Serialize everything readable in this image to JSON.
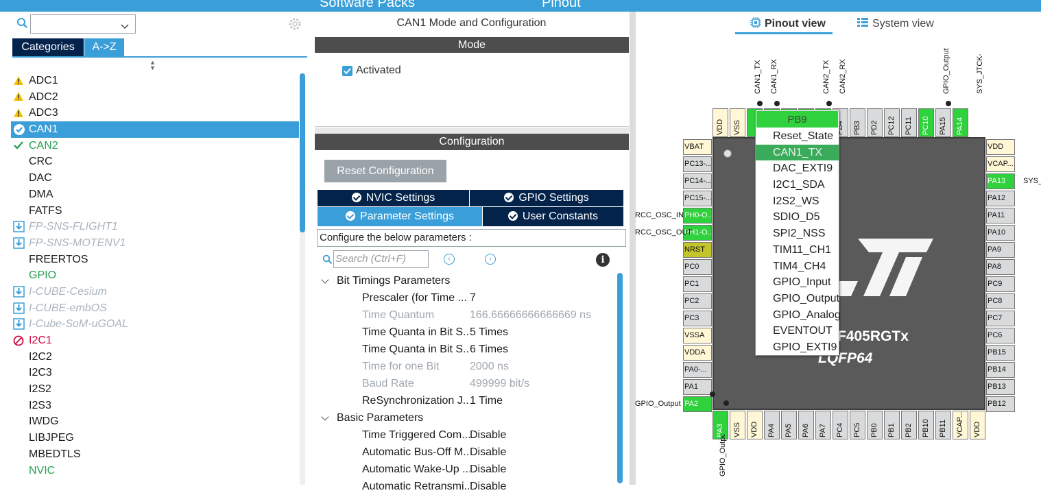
{
  "topbar": {
    "left_label": "Software Packs",
    "right_label": "Pinout"
  },
  "left_panel": {
    "search_value": "",
    "tabs": [
      {
        "label": "Categories"
      },
      {
        "label": "A->Z"
      }
    ],
    "items": [
      {
        "label": "ADC1",
        "state": "warning"
      },
      {
        "label": "ADC2",
        "state": "warning"
      },
      {
        "label": "ADC3",
        "state": "warning"
      },
      {
        "label": "CAN1",
        "state": "selected"
      },
      {
        "label": "CAN2",
        "state": "enabled"
      },
      {
        "label": "CRC",
        "state": "normal"
      },
      {
        "label": "DAC",
        "state": "normal"
      },
      {
        "label": "DMA",
        "state": "normal"
      },
      {
        "label": "FATFS",
        "state": "normal"
      },
      {
        "label": "FP-SNS-FLIGHT1",
        "state": "pack"
      },
      {
        "label": "FP-SNS-MOTENV1",
        "state": "pack"
      },
      {
        "label": "FREERTOS",
        "state": "normal"
      },
      {
        "label": "GPIO",
        "state": "green"
      },
      {
        "label": "I-CUBE-Cesium",
        "state": "pack"
      },
      {
        "label": "I-CUBE-embOS",
        "state": "pack"
      },
      {
        "label": "I-Cube-SoM-uGOAL",
        "state": "pack"
      },
      {
        "label": "I2C1",
        "state": "error"
      },
      {
        "label": "I2C2",
        "state": "normal"
      },
      {
        "label": "I2C3",
        "state": "normal"
      },
      {
        "label": "I2S2",
        "state": "normal"
      },
      {
        "label": "I2S3",
        "state": "normal"
      },
      {
        "label": "IWDG",
        "state": "normal"
      },
      {
        "label": "LIBJPEG",
        "state": "normal"
      },
      {
        "label": "MBEDTLS",
        "state": "normal"
      },
      {
        "label": "NVIC",
        "state": "green"
      }
    ]
  },
  "middle_panel": {
    "title": "CAN1 Mode and Configuration",
    "mode_header": "Mode",
    "activated_label": "Activated",
    "activated": true,
    "config_header": "Configuration",
    "reset_button": "Reset Configuration",
    "settings_tabs": [
      {
        "label": "NVIC Settings"
      },
      {
        "label": "GPIO Settings"
      },
      {
        "label": "Parameter Settings"
      },
      {
        "label": "User Constants"
      }
    ],
    "param_hint": "Configure the below parameters :",
    "search_placeholder": "Search (Ctrl+F)",
    "sections": [
      {
        "title": "Bit Timings Parameters",
        "rows": [
          {
            "key": "Prescaler (for Time ...",
            "value": "7",
            "disabled": false
          },
          {
            "key": "Time Quantum",
            "value": "166.66666666666669 ns",
            "disabled": true
          },
          {
            "key": "Time Quanta in Bit S...",
            "value": "5 Times",
            "disabled": false
          },
          {
            "key": "Time Quanta in Bit S...",
            "value": "6 Times",
            "disabled": false
          },
          {
            "key": "Time for one Bit",
            "value": "2000 ns",
            "disabled": true
          },
          {
            "key": "Baud Rate",
            "value": "499999 bit/s",
            "disabled": true
          },
          {
            "key": "ReSynchronization J...",
            "value": "1 Time",
            "disabled": false
          }
        ]
      },
      {
        "title": "Basic Parameters",
        "rows": [
          {
            "key": "Time Triggered Com...",
            "value": "Disable",
            "disabled": false
          },
          {
            "key": "Automatic Bus-Off M...",
            "value": "Disable",
            "disabled": false
          },
          {
            "key": "Automatic Wake-Up ...",
            "value": "Disable",
            "disabled": false
          },
          {
            "key": "Automatic Retransmi...",
            "value": "Disable",
            "disabled": false
          }
        ]
      }
    ]
  },
  "right_panel": {
    "tabs": [
      {
        "label": "Pinout view"
      },
      {
        "label": "System view"
      }
    ],
    "chip_part": "F405RGTx",
    "chip_package": "LQFP64",
    "top_labels": {
      "can1_tx": "CAN1_TX",
      "can1_rx": "CAN1_RX",
      "can2_tx": "CAN2_TX",
      "can2_rx": "CAN2_RX",
      "gpio_output": "GPIO_Output",
      "sys_jtck": "SYS_JTCK-SW"
    },
    "side_labels": {
      "osc_in": "RCC_OSC_IN",
      "osc_out": "RCC_OSC_OUT",
      "gpio_output_left": "GPIO_Output",
      "sys_right": "SYS_",
      "gpio_output_bottom": "GPIO_Output"
    },
    "top_pins": [
      "VDD",
      "VSS",
      "",
      "",
      "",
      "",
      "PB5",
      "PB4",
      "PB3",
      "PD2",
      "PC12",
      "PC11",
      "PC10",
      "PA15",
      "PA14"
    ],
    "left_pins": [
      "VBAT",
      "PC13-...",
      "PC14-...",
      "PC15-...",
      "PH0-O...",
      "PH1-O...",
      "NRST",
      "PC0",
      "PC1",
      "PC2",
      "PC3",
      "VSSA",
      "VDDA",
      "PA0-...",
      "PA1",
      "PA2"
    ],
    "right_pins": [
      "VDD",
      "VCAP...",
      "PA13",
      "PA12",
      "PA11",
      "PA10",
      "PA9",
      "PA8",
      "PC9",
      "PC8",
      "PC7",
      "PC6",
      "PB15",
      "PB14",
      "PB13",
      "PB12"
    ],
    "bottom_pins": [
      "PA3",
      "VSS",
      "VDD",
      "PA4",
      "PA5",
      "PA6",
      "PA7",
      "PC4",
      "PC5",
      "PB0",
      "PB1",
      "PB2",
      "PB10",
      "PB11",
      "VCAP...",
      "VDD"
    ]
  },
  "popup": {
    "header": "PB9",
    "items": [
      {
        "label": "Reset_State",
        "selected": false
      },
      {
        "label": "CAN1_TX",
        "selected": true
      },
      {
        "label": "DAC_EXTI9",
        "selected": false
      },
      {
        "label": "I2C1_SDA",
        "selected": false
      },
      {
        "label": "I2S2_WS",
        "selected": false
      },
      {
        "label": "SDIO_D5",
        "selected": false
      },
      {
        "label": "SPI2_NSS",
        "selected": false
      },
      {
        "label": "TIM11_CH1",
        "selected": false
      },
      {
        "label": "TIM4_CH4",
        "selected": false
      },
      {
        "label": "GPIO_Input",
        "selected": false
      },
      {
        "label": "GPIO_Output",
        "selected": false
      },
      {
        "label": "GPIO_Analog",
        "selected": false
      },
      {
        "label": "EVENTOUT",
        "selected": false
      },
      {
        "label": "GPIO_EXTI9",
        "selected": false
      }
    ]
  },
  "colors": {
    "accent": "#3a9fd8",
    "navy": "#03234b",
    "pin_green": "#2fd13c",
    "error": "#cc0a3b",
    "ok": "#25a150"
  }
}
